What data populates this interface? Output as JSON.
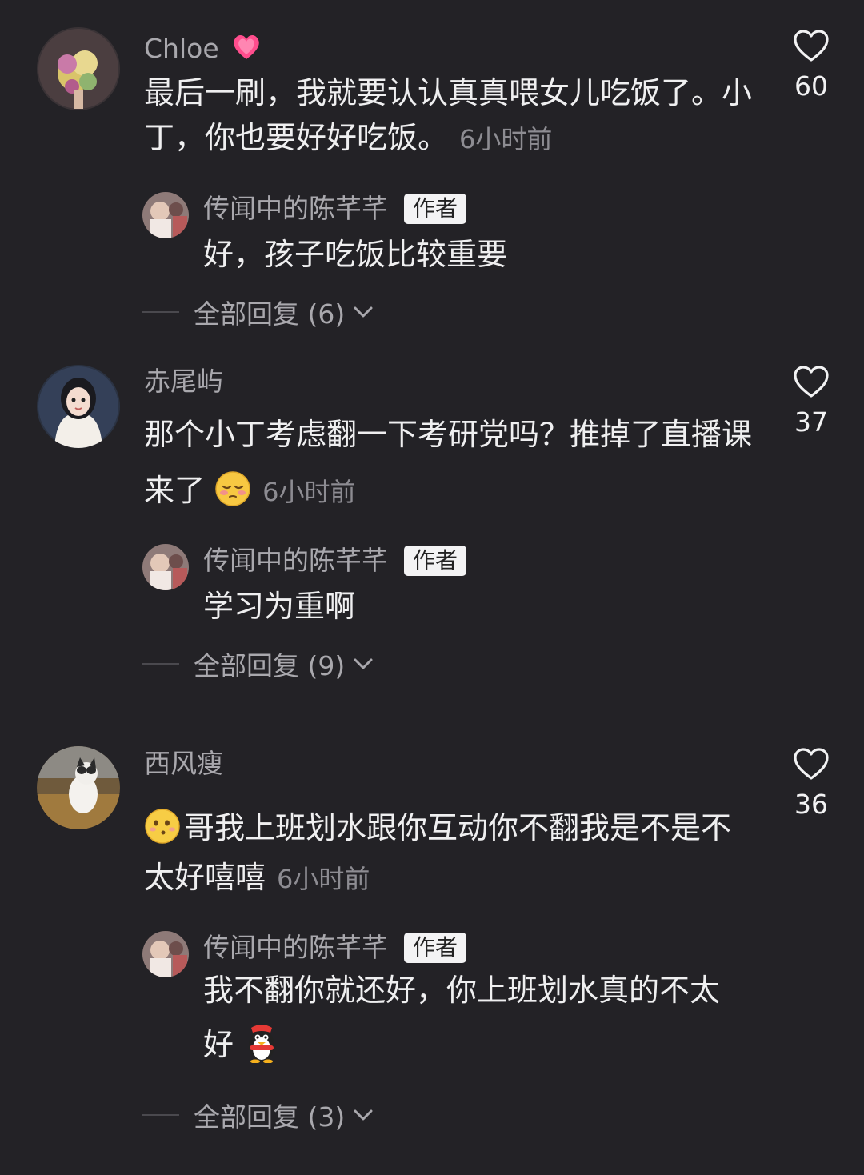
{
  "comments": [
    {
      "username": "Chloe",
      "username_emoji": "heart-emoji",
      "text": "最后一刷，我就要认认真真喂女儿吃饭了。小丁，你也要好好吃饭。",
      "time": "6小时前",
      "likes": "60",
      "reply": {
        "username": "传闻中的陈芊芊",
        "badge": "作者",
        "text": "好，孩子吃饭比较重要"
      },
      "view_replies": "全部回复 (6)"
    },
    {
      "username": "赤尾屿",
      "text": "那个小丁考虑翻一下考研党吗？推掉了直播课来了",
      "text_emoji": "shy-face-emoji",
      "time": "6小时前",
      "likes": "37",
      "reply": {
        "username": "传闻中的陈芊芊",
        "badge": "作者",
        "text": "学习为重啊"
      },
      "view_replies": "全部回复 (9)"
    },
    {
      "username": "西风瘦",
      "text_emoji": "smirk-face-emoji",
      "text": "哥我上班划水跟你互动你不翻我是不是不太好嘻嘻",
      "time": "6小时前",
      "likes": "36",
      "reply": {
        "username": "传闻中的陈芊芊",
        "badge": "作者",
        "text": "我不翻你就还好，你上班划水真的不太好",
        "text_emoji": "penguin-emoji"
      },
      "view_replies": "全部回复 (3)"
    }
  ],
  "colors": {
    "background": "#232226",
    "text": "#efeff0",
    "secondary": "#a9a8ad",
    "badge_bg": "#f3f3f4",
    "heart_emoji": "#ff4d8d"
  }
}
